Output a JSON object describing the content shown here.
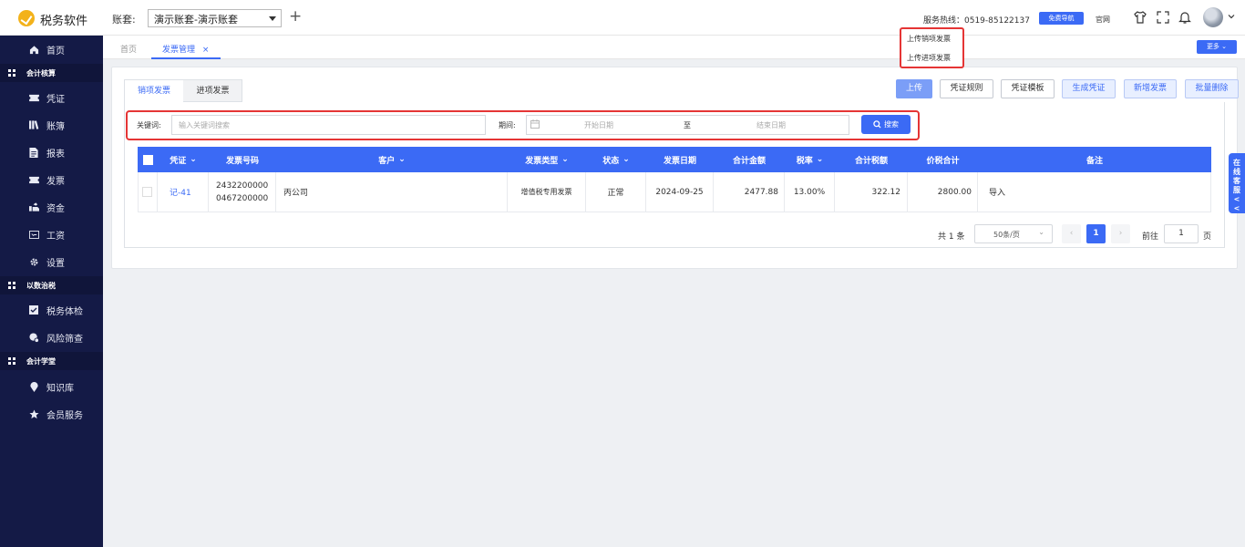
{
  "app": {
    "name": "税务软件",
    "account_label": "账套:",
    "account_value": "演示账套-演示账套"
  },
  "header": {
    "hotline": "服务热线：0519-85122137",
    "free_nav": "免费导航",
    "official_site": "官网"
  },
  "tabs": {
    "home": "首页",
    "invoice": "发票管理"
  },
  "more_button": "更多",
  "sidebar": {
    "home": "首页",
    "group_accounting": "会计核算",
    "voucher": "凭证",
    "ledger": "账簿",
    "report": "报表",
    "invoice": "发票",
    "funds": "资金",
    "salary": "工资",
    "settings": "设置",
    "group_tax": "以数治税",
    "tax_check": "税务体检",
    "risk_scan": "风险筛查",
    "group_school": "会计学堂",
    "knowledge": "知识库",
    "member": "会员服务"
  },
  "invoice_tabs": {
    "sales": "销项发票",
    "purchase": "进项发票"
  },
  "toolbar": {
    "upload": "上传",
    "voucher_rules": "凭证规则",
    "voucher_template": "凭证模板",
    "generate_voucher": "生成凭证",
    "add_invoice": "新增发票",
    "batch_delete": "批量删除"
  },
  "upload_menu": {
    "sales": "上传销项发票",
    "purchase": "上传进项发票"
  },
  "search": {
    "keyword_label": "关键词:",
    "keyword_placeholder": "输入关键词搜索",
    "period_label": "期间:",
    "start_placeholder": "开始日期",
    "separator": "至",
    "end_placeholder": "结束日期",
    "button": "搜索"
  },
  "table": {
    "headers": {
      "voucher": "凭证",
      "invoice_no": "发票号码",
      "customer": "客户",
      "invoice_type": "发票类型",
      "status": "状态",
      "invoice_date": "发票日期",
      "amount": "合计金额",
      "tax_rate": "税率",
      "tax_amount": "合计税额",
      "total": "价税合计",
      "remark": "备注"
    },
    "rows": [
      {
        "voucher": "记-41",
        "invoice_no_1": "2432200000",
        "invoice_no_2": "0467200000",
        "customer": "丙公司",
        "invoice_type": "增值税专用发票",
        "status": "正常",
        "invoice_date": "2024-09-25",
        "amount": "2477.88",
        "tax_rate": "13.00%",
        "tax_amount": "322.12",
        "total": "2800.00",
        "remark": "导入"
      }
    ]
  },
  "pager": {
    "total": "共 1 条",
    "page_size": "50条/页",
    "current": "1",
    "goto_label": "前往",
    "goto_value": "1",
    "page_unit": "页"
  },
  "online_service": "在线客服<<",
  "colors": {
    "primary": "#3b6af5",
    "sidebar": "#141a46",
    "highlight": "#e53535"
  }
}
